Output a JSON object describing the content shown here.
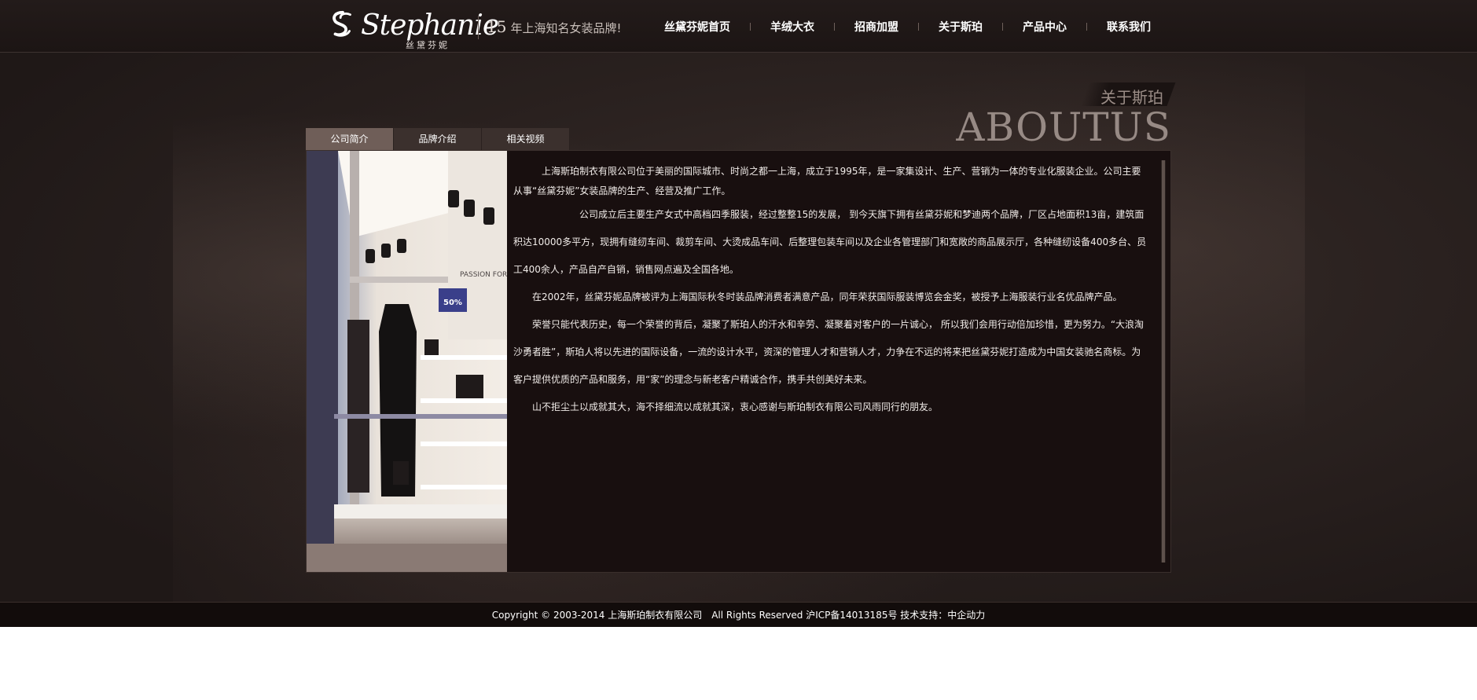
{
  "header": {
    "logo_text": "Stephanie",
    "logo_sub": "丝黛芬妮",
    "tagline_number": "15",
    "tagline_text": "年上海知名女装品牌!"
  },
  "nav": {
    "items": [
      "丝黛芬妮首页",
      "羊绒大衣",
      "招商加盟",
      "关于斯珀",
      "产品中心",
      "联系我们"
    ]
  },
  "about": {
    "title_cn": "关于斯珀",
    "title_en": "ABOUTUS"
  },
  "tabs": [
    {
      "label": "公司简介",
      "active": true
    },
    {
      "label": "品牌介绍",
      "active": false
    },
    {
      "label": "相关视频",
      "active": false
    }
  ],
  "photo": {
    "sign_text": "PASSION FOR",
    "sale_tag": "50%"
  },
  "content": {
    "paragraphs": [
      "　　　上海斯珀制衣有限公司位于美丽的国际城市、时尚之都一上海，成立于1995年，是一家集设计、生产、营销为一体的专业化服装企业。公司主要从事“丝黛芬妮”女装品牌的生产、经营及推广工作。",
      "　　　　　　　公司成立后主要生产女式中高档四季服装，经过整整15的发展， 到今天旗下拥有丝黛芬妮和梦迪两个品牌，厂区占地面积13亩，建筑面积达10000多平方，现拥有缝纫车间、裁剪车间、大烫成品车间、后整理包装车间以及企业各管理部门和宽敞的商品展示厅，各种缝纫设备400多台、员工400余人，产品自产自销，销售网点遍及全国各地。",
      "　　在2002年，丝黛芬妮品牌被评为上海国际秋冬时装品牌消费者满意产品，同年荣获国际服装博览会金奖，被授予上海服装行业名优品牌产品。",
      "　　荣誉只能代表历史，每一个荣誉的背后，凝聚了斯珀人的汗水和辛劳、凝聚着对客户的一片诚心， 所以我们会用行动倍加珍惜，更为努力。“大浪淘沙勇者胜”，斯珀人将以先进的国际设备，一流的设计水平，资深的管理人才和营销人才，力争在不远的将来把丝黛芬妮打造成为中国女装驰名商标。为客户提供优质的产品和服务，用“家”的理念与新老客户精诚合作，携手共创美好未来。",
      "　　山不拒尘土以成就其大，海不择细流以成就其深，衷心感谢与斯珀制衣有限公司风雨同行的朋友。"
    ]
  },
  "footer": {
    "text": "Copyright © 2003-2014 上海斯珀制衣有限公司　All Rights Reserved 沪ICP备14013185号 技术支持：中企动力"
  },
  "colors": {
    "background": "#2b2220",
    "header": "#1e1716",
    "panel": "#180f0f",
    "tab_active": "#6f5e58",
    "tab_inactive": "#3b302d"
  }
}
